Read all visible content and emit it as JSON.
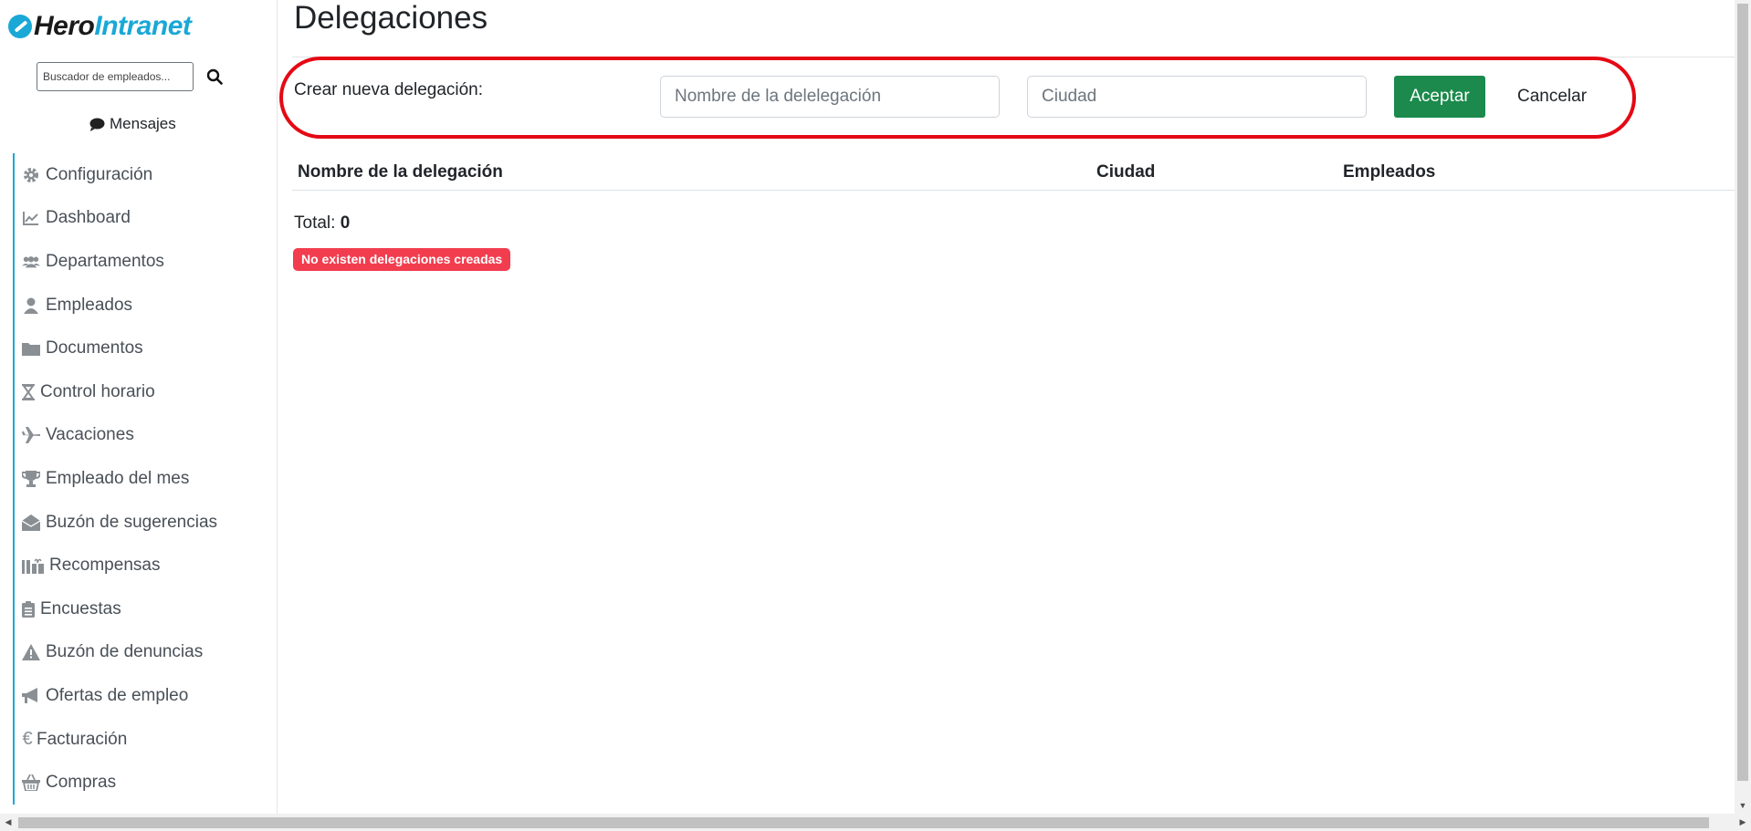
{
  "brand": {
    "part1": "Hero",
    "part2": "Intranet"
  },
  "sidebar": {
    "search_placeholder": "Buscador de empleados...",
    "messages_label": "Mensajes",
    "items": [
      {
        "label": "Configuración",
        "icon": "gear-icon"
      },
      {
        "label": "Dashboard",
        "icon": "chart-line-icon"
      },
      {
        "label": "Departamentos",
        "icon": "users-icon"
      },
      {
        "label": "Empleados",
        "icon": "user-icon"
      },
      {
        "label": "Documentos",
        "icon": "folder-icon"
      },
      {
        "label": "Control horario",
        "icon": "hourglass-icon"
      },
      {
        "label": "Vacaciones",
        "icon": "plane-icon"
      },
      {
        "label": "Empleado del mes",
        "icon": "trophy-icon"
      },
      {
        "label": "Buzón de sugerencias",
        "icon": "envelope-open-icon"
      },
      {
        "label": "Recompensas",
        "icon": "gifts-icon"
      },
      {
        "label": "Encuestas",
        "icon": "clipboard-icon"
      },
      {
        "label": "Buzón de denuncias",
        "icon": "warning-icon"
      },
      {
        "label": "Ofertas de empleo",
        "icon": "megaphone-icon"
      },
      {
        "label": "Facturación",
        "icon": "euro-icon"
      },
      {
        "label": "Compras",
        "icon": "basket-icon"
      }
    ]
  },
  "main": {
    "title": "Delegaciones",
    "create": {
      "label": "Crear nueva delegación:",
      "name_placeholder": "Nombre de la delelegación",
      "city_placeholder": "Ciudad",
      "accept_label": "Aceptar",
      "cancel_label": "Cancelar"
    },
    "table": {
      "headers": {
        "name": "Nombre de la delegación",
        "city": "Ciudad",
        "employees": "Empleados"
      }
    },
    "total_label": "Total:",
    "total_value": "0",
    "empty_badge": "No existen delegaciones creadas"
  },
  "colors": {
    "accent": "#1aa8d6",
    "accept": "#1b8a4c",
    "badge": "#f23d4f",
    "highlight": "#e50914"
  }
}
